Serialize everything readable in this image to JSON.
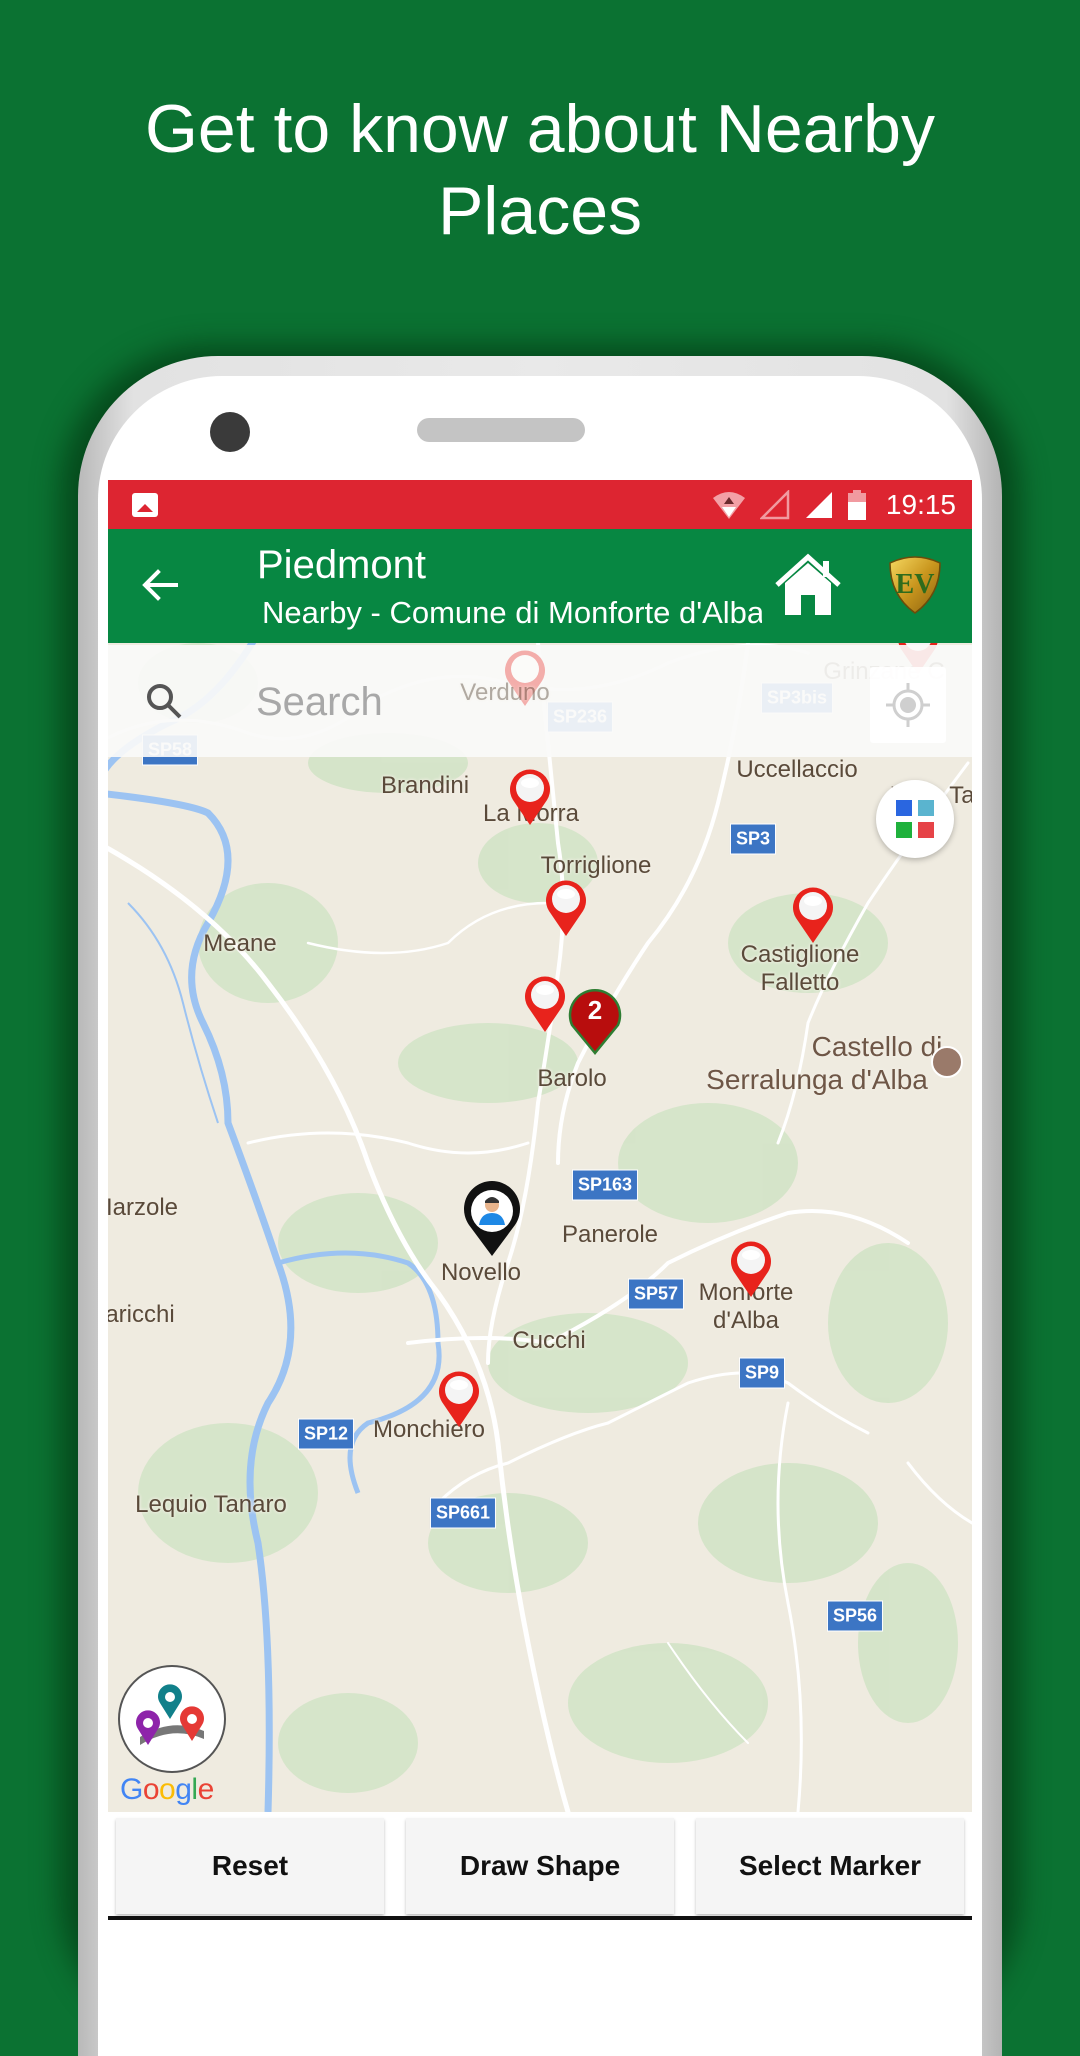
{
  "headline": {
    "line1": "Get to know about Nearby",
    "line2": "Places"
  },
  "status_bar": {
    "time": "19:15",
    "icons": [
      "gallery-icon",
      "wifi-icon",
      "signal-empty-icon",
      "signal-full-icon",
      "battery-icon"
    ]
  },
  "app_bar": {
    "title": "Piedmont",
    "subtitle": "Nearby - Comune di Monforte d'Alba",
    "icons": [
      "back-arrow-icon",
      "home-icon",
      "ev-logo"
    ]
  },
  "search": {
    "placeholder": "Search",
    "value": ""
  },
  "map": {
    "places": [
      {
        "name": "Verduno"
      },
      {
        "name": "Grinzane C"
      },
      {
        "name": "Brandini"
      },
      {
        "name": "La Morra"
      },
      {
        "name": "Uccellaccio"
      },
      {
        "name": "Valle Ta"
      },
      {
        "name": "Torriglione"
      },
      {
        "name": "Meane"
      },
      {
        "name": "Castiglione"
      },
      {
        "name": "Falletto"
      },
      {
        "name": "Castello di"
      },
      {
        "name": "Serralunga d'Alba"
      },
      {
        "name": "Barolo"
      },
      {
        "name": "Iarzole"
      },
      {
        "name": "Panerole"
      },
      {
        "name": "Novello"
      },
      {
        "name": "aricchi"
      },
      {
        "name": "Monforte"
      },
      {
        "name": "d'Alba"
      },
      {
        "name": "Cucchi"
      },
      {
        "name": "Monchiero"
      },
      {
        "name": "Lequio Tanaro"
      }
    ],
    "roads": [
      "SP58",
      "SP236",
      "SP3bis",
      "SP3",
      "SP163",
      "SP57",
      "SP9",
      "SP12",
      "SP661",
      "SP56"
    ],
    "cluster_count": "2",
    "attribution": "Google"
  },
  "buttons": {
    "reset": "Reset",
    "draw_shape": "Draw Shape",
    "select_marker": "Select Marker"
  },
  "colors": {
    "background": "#0b7232",
    "status_bar": "#dd2531",
    "app_bar": "#078742",
    "marker": "#e8231c",
    "cluster": "#b80d0d",
    "road_shield": "#3c75c4"
  }
}
